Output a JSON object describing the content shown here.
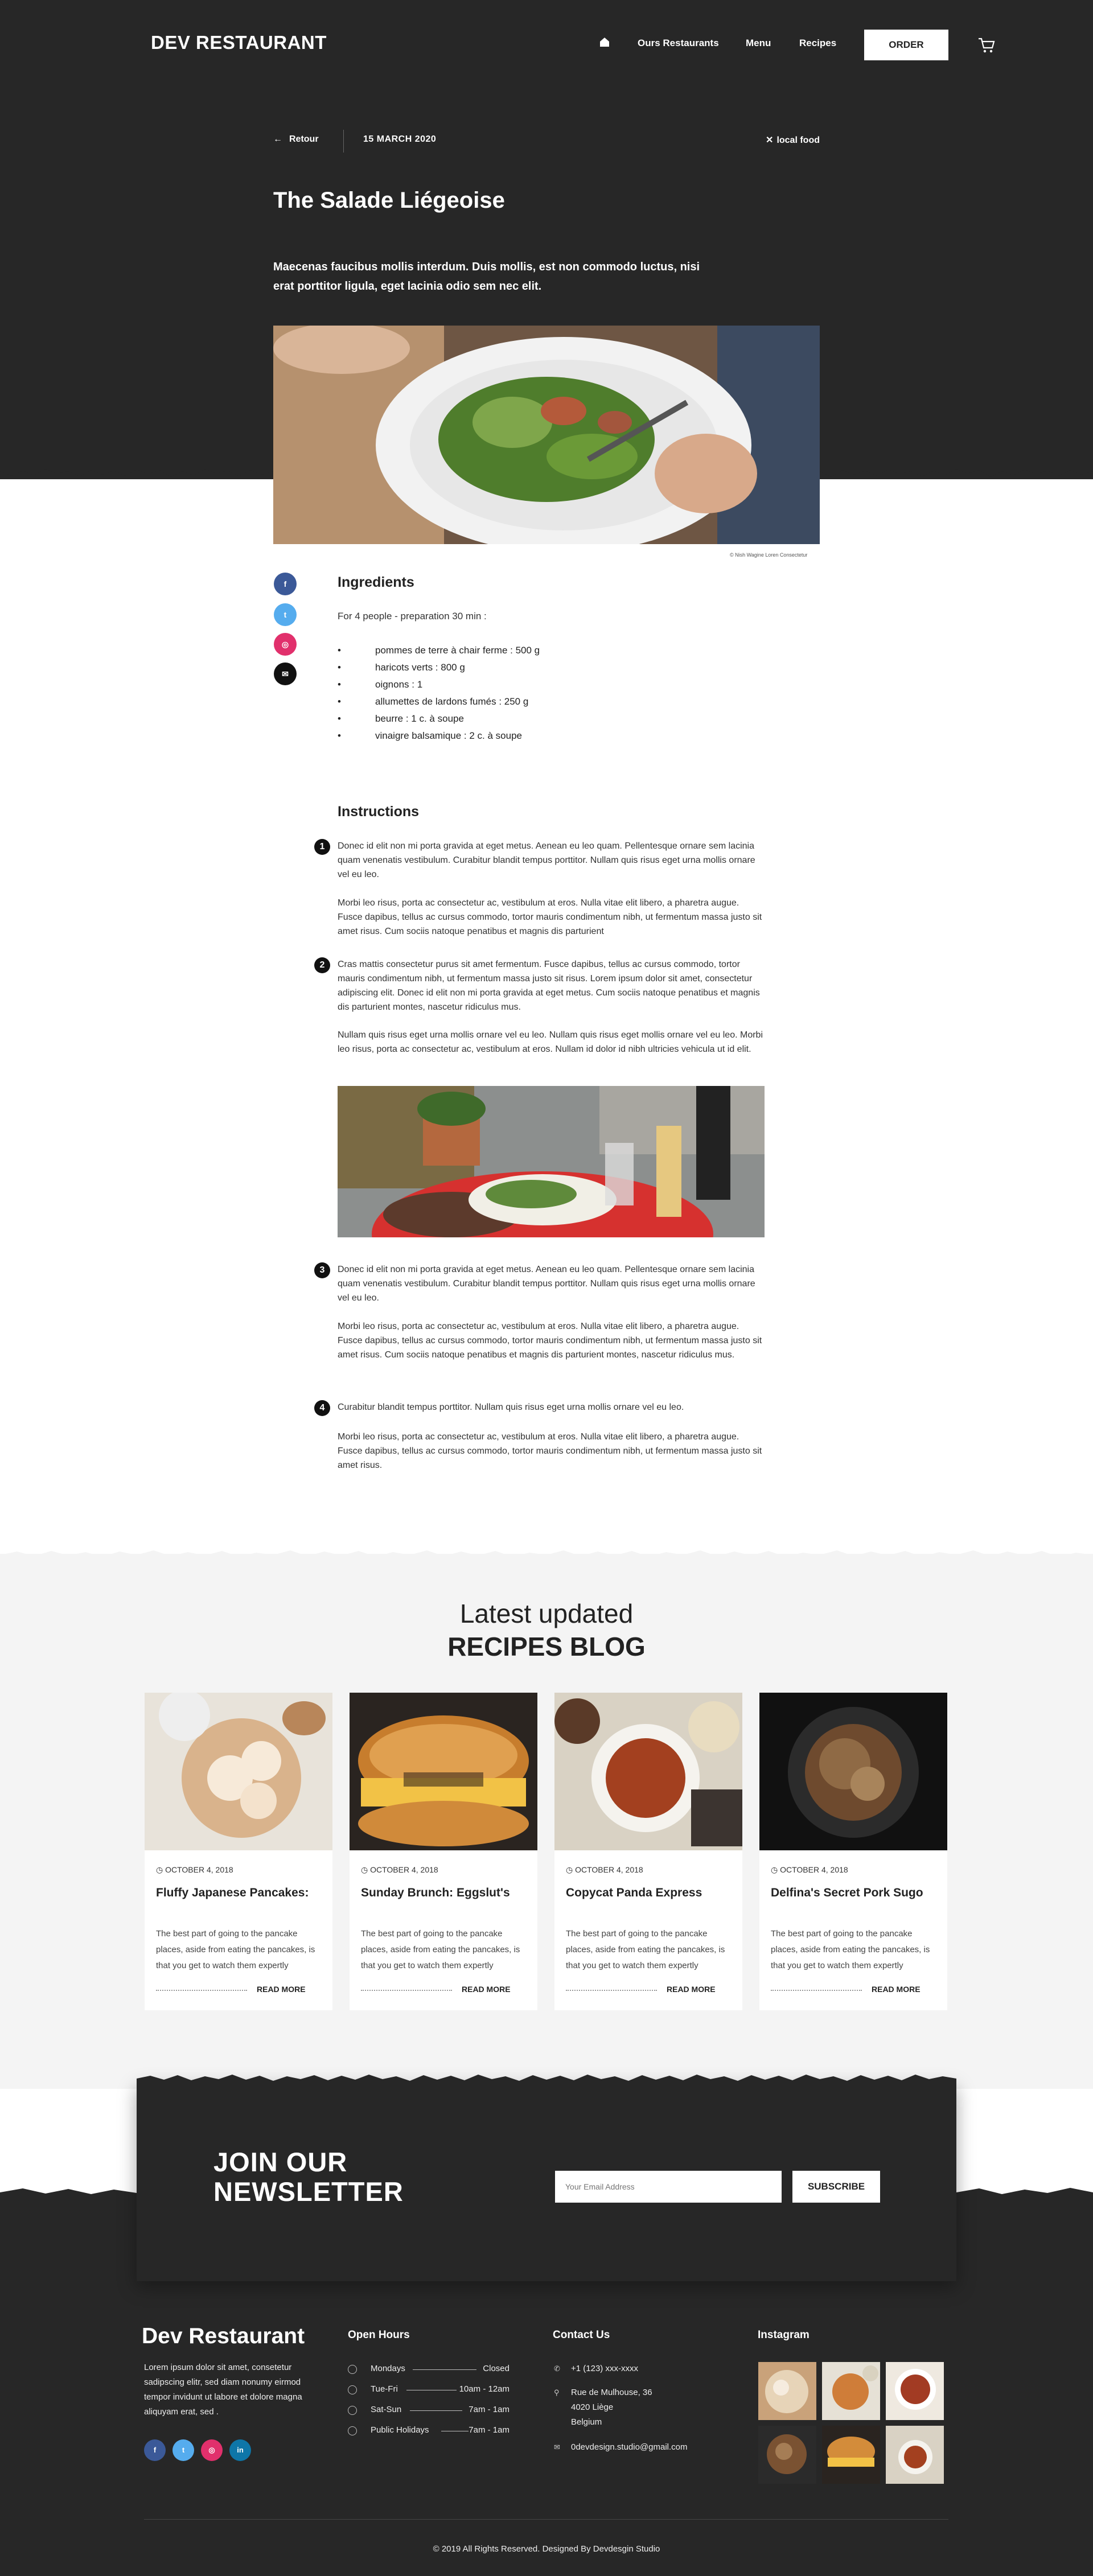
{
  "header": {
    "logo": "DEV RESTAURANT",
    "nav": [
      "Ours Restaurants",
      "Menu",
      "Recipes"
    ],
    "order": "ORDER"
  },
  "meta": {
    "back": "Retour",
    "date": "15 MARCH 2020",
    "tag": "local food"
  },
  "article": {
    "title": "The Salade Liégeoise",
    "lead": "Maecenas faucibus mollis interdum. Duis mollis, est non commodo luctus, nisi erat porttitor ligula, eget lacinia odio sem nec elit.",
    "credit": "© Nish Wagine Loren Consectetur",
    "ingredients_title": "Ingredients",
    "ingredients_intro": "For 4 people - preparation 30 min :",
    "ingredients": [
      "pommes de terre à chair ferme : 500 g",
      "haricots verts : 800 g",
      "oignons : 1",
      "allumettes de lardons fumés : 250 g",
      "beurre : 1 c. à soupe",
      "vinaigre balsamique : 2 c. à soupe"
    ],
    "instructions_title": "Instructions",
    "steps": [
      {
        "n": "1",
        "p1": "Donec id elit non mi porta gravida at eget metus. Aenean eu leo quam. Pellentesque ornare sem lacinia quam venenatis vestibulum. Curabitur blandit tempus porttitor. Nullam quis risus eget urna mollis ornare vel eu leo.",
        "p2": "Morbi leo risus, porta ac consectetur ac, vestibulum at eros. Nulla vitae elit libero, a pharetra augue. Fusce dapibus, tellus ac cursus commodo, tortor mauris condimentum nibh, ut fermentum massa justo sit amet risus. Cum sociis natoque penatibus et magnis dis parturient"
      },
      {
        "n": "2",
        "p1": "Cras mattis consectetur purus sit amet fermentum. Fusce dapibus, tellus ac cursus commodo, tortor mauris condimentum nibh, ut fermentum massa justo sit risus. Lorem ipsum dolor sit amet, consectetur adipiscing elit. Donec id elit non mi porta gravida at eget metus. Cum sociis natoque penatibus et magnis dis parturient montes, nascetur ridiculus mus.",
        "p2": "Nullam quis risus eget urna mollis ornare vel eu leo. Nullam quis risus eget  mollis ornare vel eu leo. Morbi leo risus, porta ac consectetur ac, vestibulum at eros. Nullam id dolor id nibh ultricies vehicula ut id elit."
      },
      {
        "n": "3",
        "p1": "Donec id elit non mi porta gravida at eget metus. Aenean eu leo quam. Pellentesque ornare sem lacinia quam venenatis vestibulum. Curabitur blandit tempus porttitor. Nullam quis risus eget urna mollis ornare vel eu leo.",
        "p2": "Morbi leo risus, porta ac consectetur ac, vestibulum at eros. Nulla vitae elit libero, a pharetra augue. Fusce dapibus, tellus ac cursus commodo, tortor mauris condimentum nibh, ut fermentum massa justo sit amet risus. Cum sociis natoque penatibus et magnis dis parturient montes, nascetur ridiculus mus."
      },
      {
        "n": "4",
        "p1": "Curabitur blandit tempus porttitor. Nullam quis risus eget urna mollis ornare vel eu leo.",
        "p2": "Morbi leo risus, porta ac consectetur ac, vestibulum at eros. Nulla vitae elit libero, a pharetra augue. Fusce dapibus, tellus ac cursus commodo, tortor mauris condimentum nibh, ut fermentum massa justo sit amet risus."
      }
    ]
  },
  "blog": {
    "title1": "Latest updated",
    "title2": "RECIPES BLOG",
    "cards": [
      {
        "date": "OCTOBER 4, 2018",
        "title": "Fluffy Japanese Pancakes:",
        "text": "The best part of going to the pancake places, aside from eating the pancakes, is that you get to watch them expertly",
        "more": "READ MORE"
      },
      {
        "date": "OCTOBER 4, 2018",
        "title": "Sunday Brunch: Eggslut's",
        "text": "The best part of going to the pancake places, aside from eating the pancakes, is that you get to watch them expertly",
        "more": "READ MORE"
      },
      {
        "date": "OCTOBER 4, 2018",
        "title": "Copycat Panda Express",
        "text": "The best part of going to the pancake places, aside from eating the pancakes, is that you get to watch them expertly",
        "more": "READ MORE"
      },
      {
        "date": "OCTOBER 4, 2018",
        "title": "Delfina's Secret Pork Sugo",
        "text": "The best part of going to the pancake places, aside from eating the pancakes, is that you get to watch them expertly",
        "more": "READ MORE"
      }
    ]
  },
  "newsletter": {
    "title1": "JOIN OUR",
    "title2": "NEWSLETTER",
    "placeholder": "Your Email Address",
    "button": "SUBSCRIBE"
  },
  "footer": {
    "logo": "Dev Restaurant",
    "about": "Lorem ipsum dolor sit amet, consetetur sadipscing elitr, sed diam nonumy eirmod tempor invidunt ut labore et dolore magna aliquyam erat, sed .",
    "hours_title": "Open Hours",
    "hours": [
      {
        "day": "Mondays",
        "time": "Closed"
      },
      {
        "day": "Tue-Fri",
        "time": "10am - 12am"
      },
      {
        "day": "Sat-Sun",
        "time": "7am - 1am"
      },
      {
        "day": "Public Holidays",
        "time": "7am - 1am"
      }
    ],
    "contact_title": "Contact Us",
    "phone": "+1 (123) xxx-xxxx",
    "address1": "Rue de Mulhouse, 36",
    "address2": "4020 Liège",
    "address3": "Belgium",
    "email": "0devdesign.studio@gmail.com",
    "insta_title": "Instagram",
    "copyright": "© 2019 All Rights Reserved. Designed By    Devdesgin Studio"
  }
}
